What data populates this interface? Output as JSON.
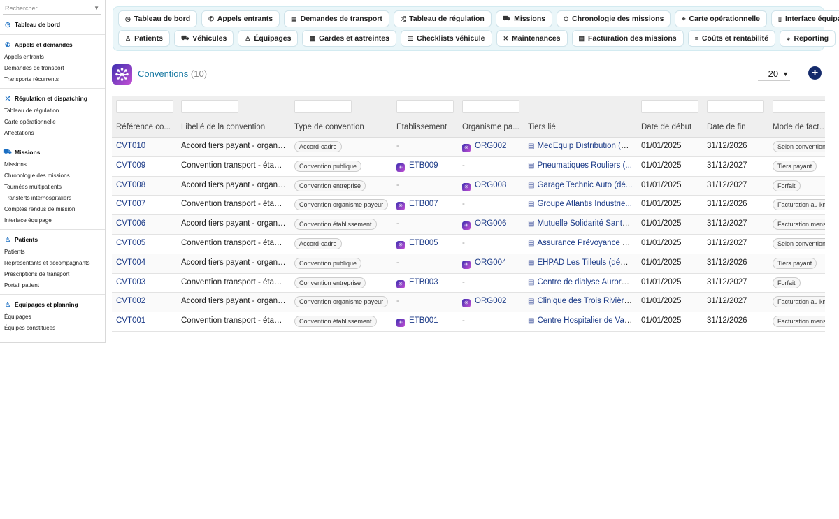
{
  "search": {
    "placeholder": "Rechercher"
  },
  "sidebar": {
    "sections": [
      {
        "title": "Tableau de bord",
        "icon": "dashboard-icon",
        "items": []
      },
      {
        "title": "Appels et demandes",
        "icon": "phone-icon",
        "items": [
          "Appels entrants",
          "Demandes de transport",
          "Transports récurrents"
        ]
      },
      {
        "title": "Régulation et dispatching",
        "icon": "shuffle-icon",
        "items": [
          "Tableau de régulation",
          "Carte opérationnelle",
          "Affectations"
        ]
      },
      {
        "title": "Missions",
        "icon": "truck-icon",
        "items": [
          "Missions",
          "Chronologie des missions",
          "Tournées multipatients",
          "Transferts interhospitaliers",
          "Comptes rendus de mission",
          "Interface équipage"
        ]
      },
      {
        "title": "Patients",
        "icon": "person-icon",
        "items": [
          "Patients",
          "Représentants et accompagnants",
          "Prescriptions de transport",
          "Portail patient"
        ]
      },
      {
        "title": "Équipages et planning",
        "icon": "team-icon",
        "items": [
          "Équipages",
          "Équipes constituées"
        ]
      }
    ]
  },
  "nav": {
    "row1": [
      {
        "label": "Tableau de bord",
        "icon": "◷"
      },
      {
        "label": "Appels entrants",
        "icon": "✆"
      },
      {
        "label": "Demandes de transport",
        "icon": "▤"
      },
      {
        "label": "Tableau de régulation",
        "icon": "⤮"
      },
      {
        "label": "Missions",
        "icon": "⛟"
      },
      {
        "label": "Chronologie des missions",
        "icon": "⏱"
      },
      {
        "label": "Carte opérationnelle",
        "icon": "⌖"
      },
      {
        "label": "Interface équipage",
        "icon": "▯"
      }
    ],
    "row2": [
      {
        "label": "Patients",
        "icon": "♙"
      },
      {
        "label": "Véhicules",
        "icon": "⛟"
      },
      {
        "label": "Équipages",
        "icon": "♙"
      },
      {
        "label": "Gardes et astreintes",
        "icon": "▦"
      },
      {
        "label": "Checklists véhicule",
        "icon": "☰"
      },
      {
        "label": "Maintenances",
        "icon": "✕"
      },
      {
        "label": "Facturation des missions",
        "icon": "▤"
      },
      {
        "label": "Coûts et rentabilité",
        "icon": "≡"
      },
      {
        "label": "Reporting",
        "icon": "◕"
      }
    ]
  },
  "page": {
    "title": "Conventions",
    "count": "(10)",
    "page_size": "20",
    "add_label": "+"
  },
  "table": {
    "headers": [
      "Référence co...",
      "Libellé de la convention",
      "Type de convention",
      "Établissement",
      "Organisme pa...",
      "Tiers lié",
      "Date de début",
      "Date de fin",
      "Mode de factur..."
    ],
    "rows": [
      {
        "ref": "CVT010",
        "label": "Accord tiers payant - organi...",
        "type": "Accord-cadre",
        "etab": "-",
        "org": "ORG002",
        "tiers": "MedEquip Distribution (dé...",
        "start": "01/01/2025",
        "end": "31/12/2026",
        "mode": "Selon convention"
      },
      {
        "ref": "CVT009",
        "label": "Convention transport - établi...",
        "type": "Convention publique",
        "etab": "ETB009",
        "org": "-",
        "tiers": "Pneumatiques Rouliers (...",
        "start": "01/01/2025",
        "end": "31/12/2027",
        "mode": "Tiers payant"
      },
      {
        "ref": "CVT008",
        "label": "Accord tiers payant - organi...",
        "type": "Convention entreprise",
        "etab": "-",
        "org": "ORG008",
        "tiers": "Garage Technic Auto (dé...",
        "start": "01/01/2025",
        "end": "31/12/2027",
        "mode": "Forfait"
      },
      {
        "ref": "CVT007",
        "label": "Convention transport - établi...",
        "type": "Convention organisme payeur",
        "etab": "ETB007",
        "org": "-",
        "tiers": "Groupe Atlantis Industrie...",
        "start": "01/01/2025",
        "end": "31/12/2026",
        "mode": "Facturation au km"
      },
      {
        "ref": "CVT006",
        "label": "Accord tiers payant - organi...",
        "type": "Convention établissement",
        "etab": "-",
        "org": "ORG006",
        "tiers": "Mutuelle Solidarité Santé ...",
        "start": "01/01/2025",
        "end": "31/12/2027",
        "mode": "Facturation mensuelle"
      },
      {
        "ref": "CVT005",
        "label": "Convention transport - établi...",
        "type": "Accord-cadre",
        "etab": "ETB005",
        "org": "-",
        "tiers": "Assurance Prévoyance N...",
        "start": "01/01/2025",
        "end": "31/12/2027",
        "mode": "Selon convention"
      },
      {
        "ref": "CVT004",
        "label": "Accord tiers payant - organi...",
        "type": "Convention publique",
        "etab": "-",
        "org": "ORG004",
        "tiers": "EHPAD Les Tilleuls (démo)",
        "start": "01/01/2025",
        "end": "31/12/2026",
        "mode": "Tiers payant"
      },
      {
        "ref": "CVT003",
        "label": "Convention transport - établi...",
        "type": "Convention entreprise",
        "etab": "ETB003",
        "org": "-",
        "tiers": "Centre de dialyse Aurore ...",
        "start": "01/01/2025",
        "end": "31/12/2027",
        "mode": "Forfait"
      },
      {
        "ref": "CVT002",
        "label": "Accord tiers payant - organi...",
        "type": "Convention organisme payeur",
        "etab": "-",
        "org": "ORG002",
        "tiers": "Clinique des Trois Rivière...",
        "start": "01/01/2025",
        "end": "31/12/2027",
        "mode": "Facturation au km"
      },
      {
        "ref": "CVT001",
        "label": "Convention transport - établi...",
        "type": "Convention établissement",
        "etab": "ETB001",
        "org": "-",
        "tiers": "Centre Hospitalier de Val-...",
        "start": "01/01/2025",
        "end": "31/12/2026",
        "mode": "Facturation mensuelle"
      }
    ]
  },
  "colors": {
    "accent": "#1a7aa3",
    "link": "#1b3a87",
    "add_button": "#142a6b",
    "nav_bg": "#eaf6f9"
  }
}
